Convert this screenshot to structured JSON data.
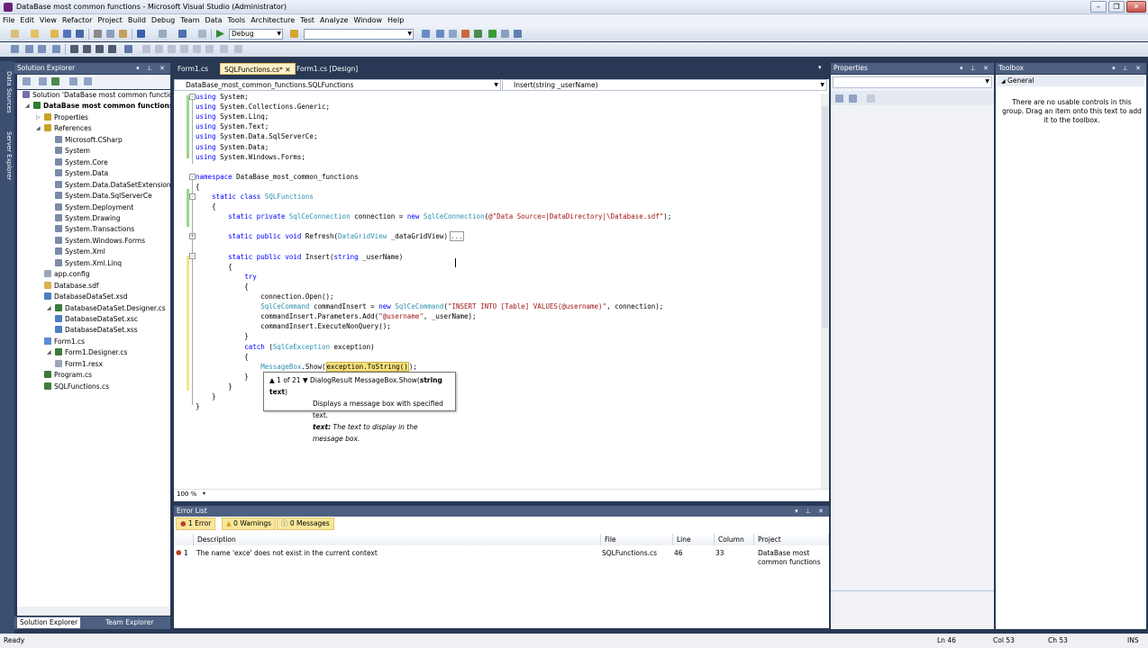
{
  "window": {
    "title": "DataBase most common functions - Microsoft Visual Studio (Administrator)"
  },
  "menu": [
    "File",
    "Edit",
    "View",
    "Refactor",
    "Project",
    "Build",
    "Debug",
    "Team",
    "Data",
    "Tools",
    "Architecture",
    "Test",
    "Analyze",
    "Window",
    "Help"
  ],
  "toolbar": {
    "config": "Debug",
    "search": ""
  },
  "left_strip": {
    "data_sources": "Data Sources",
    "server_explorer": "Server Explorer"
  },
  "solution_explorer": {
    "title": "Solution Explorer",
    "items": [
      {
        "label": "Solution 'DataBase most common functions'",
        "indent": 0,
        "color": "#7a6ab0"
      },
      {
        "label": "DataBase most common functions",
        "indent": 1,
        "color": "#2d7d2d",
        "bold": true
      },
      {
        "label": "Properties",
        "indent": 2,
        "color": "#c9a227"
      },
      {
        "label": "References",
        "indent": 2,
        "color": "#c9a227"
      },
      {
        "label": "Microsoft.CSharp",
        "indent": 3,
        "color": "#7b8ba8"
      },
      {
        "label": "System",
        "indent": 3,
        "color": "#7b8ba8"
      },
      {
        "label": "System.Core",
        "indent": 3,
        "color": "#7b8ba8"
      },
      {
        "label": "System.Data",
        "indent": 3,
        "color": "#7b8ba8"
      },
      {
        "label": "System.Data.DataSetExtensions",
        "indent": 3,
        "color": "#7b8ba8"
      },
      {
        "label": "System.Data.SqlServerCe",
        "indent": 3,
        "color": "#7b8ba8"
      },
      {
        "label": "System.Deployment",
        "indent": 3,
        "color": "#7b8ba8"
      },
      {
        "label": "System.Drawing",
        "indent": 3,
        "color": "#7b8ba8"
      },
      {
        "label": "System.Transactions",
        "indent": 3,
        "color": "#7b8ba8"
      },
      {
        "label": "System.Windows.Forms",
        "indent": 3,
        "color": "#7b8ba8"
      },
      {
        "label": "System.Xml",
        "indent": 3,
        "color": "#7b8ba8"
      },
      {
        "label": "System.Xml.Linq",
        "indent": 3,
        "color": "#7b8ba8"
      },
      {
        "label": "app.config",
        "indent": 2,
        "color": "#9aa6b8"
      },
      {
        "label": "Database.sdf",
        "indent": 2,
        "color": "#d8b24a"
      },
      {
        "label": "DatabaseDataSet.xsd",
        "indent": 2,
        "color": "#4a7fc0"
      },
      {
        "label": "DatabaseDataSet.Designer.cs",
        "indent": 3,
        "color": "#3e7a3e"
      },
      {
        "label": "DatabaseDataSet.xsc",
        "indent": 3,
        "color": "#4a7fc0"
      },
      {
        "label": "DatabaseDataSet.xss",
        "indent": 3,
        "color": "#4a7fc0"
      },
      {
        "label": "Form1.cs",
        "indent": 2,
        "color": "#5b8bd0"
      },
      {
        "label": "Form1.Designer.cs",
        "indent": 3,
        "color": "#3e7a3e"
      },
      {
        "label": "Form1.resx",
        "indent": 3,
        "color": "#9aa6b8"
      },
      {
        "label": "Program.cs",
        "indent": 2,
        "color": "#3e7a3e"
      },
      {
        "label": "SQLFunctions.cs",
        "indent": 2,
        "color": "#3e7a3e"
      }
    ],
    "bottom_tabs": [
      "Solution Explorer",
      "Team Explorer"
    ]
  },
  "doc_tabs": [
    "Form1.cs",
    "SQLFunctions.cs*",
    "Form1.cs [Design]"
  ],
  "editor": {
    "nav_left": "DataBase_most_common_functions.SQLFunctions",
    "nav_right": "Insert(string _userName)",
    "zoom": "100 %",
    "lines": [
      [
        "kw:using",
        "t: System;"
      ],
      [
        "kw:using",
        "t: System.Collections.Generic;"
      ],
      [
        "kw:using",
        "t: System.Linq;"
      ],
      [
        "kw:using",
        "t: System.Text;"
      ],
      [
        "kw:using",
        "t: System.Data.SqlServerCe;"
      ],
      [
        "kw:using",
        "t: System.Data;"
      ],
      [
        "kw:using",
        "t: System.Windows.Forms;"
      ],
      [
        "t:"
      ],
      [
        "kw:namespace",
        "t: DataBase_most_common_functions"
      ],
      [
        "t:{"
      ],
      [
        "t:    ",
        "kw:static class ",
        "ty:SQLFunctions"
      ],
      [
        "t:    {"
      ],
      [
        "t:        ",
        "kw:static private ",
        "ty:SqlCeConnection",
        "t: connection = ",
        "kw:new ",
        "ty:SqlCeConnection",
        "t:(",
        "st:@\"Data Source=|DataDirectory|\\Database.sdf\"",
        "t:);"
      ],
      [
        "t:"
      ],
      [
        "t:        ",
        "kw:static public void ",
        "t:Refresh(",
        "ty:DataGridView",
        "t: _dataGridView)",
        "b:..."
      ],
      [
        "t:"
      ],
      [
        "t:        ",
        "kw:static public void ",
        "t:Insert(",
        "kw:string",
        "t: _userName)"
      ],
      [
        "t:        {"
      ],
      [
        "t:            ",
        "kw:try"
      ],
      [
        "t:            {"
      ],
      [
        "t:                connection.Open();"
      ],
      [
        "t:                ",
        "ty:SqlCeCommand",
        "t: commandInsert = ",
        "kw:new ",
        "ty:SqlCeCommand",
        "t:(",
        "st:\"INSERT INTO [Table] VALUES(@username)\"",
        "t:, connection);"
      ],
      [
        "t:                commandInsert.Parameters.Add(",
        "st:\"@username\"",
        "t:, _userName);"
      ],
      [
        "t:                commandInsert.ExecuteNonQuery();"
      ],
      [
        "t:            }"
      ],
      [
        "t:            ",
        "kw:catch ",
        "t:(",
        "ty:SqlCeException",
        "t: exception)"
      ],
      [
        "t:            {"
      ],
      [
        "t:                ",
        "ty:MessageBox",
        "t:.Show(",
        "h:exception.ToString()",
        "t:);"
      ],
      [
        "t:            }"
      ],
      [
        "t:        }"
      ],
      [
        "t:    }"
      ],
      [
        "t:}"
      ]
    ]
  },
  "tooltip": {
    "counter": "1 of 21",
    "signature_prefix": "DialogResult MessageBox.Show(",
    "signature_param": "string text",
    "signature_suffix": ")",
    "description": "Displays a message box with specified text.",
    "param_name": "text:",
    "param_desc": "The text to display in the message box."
  },
  "properties": {
    "title": "Properties"
  },
  "toolbox": {
    "title": "Toolbox",
    "group": "General",
    "message": "There are no usable controls in this group. Drag an item onto this text to add it to the toolbox."
  },
  "error_list": {
    "title": "Error List",
    "tabs": [
      "1 Error",
      "0 Warnings",
      "0 Messages"
    ],
    "columns": [
      "Description",
      "File",
      "Line",
      "Column",
      "Project"
    ],
    "rows": [
      {
        "num": "1",
        "description": "The name 'exce' does not exist in the current context",
        "file": "SQLFunctions.cs",
        "line": "46",
        "column": "33",
        "project": "DataBase most common functions"
      }
    ]
  },
  "status": {
    "left": "Ready",
    "ln": "Ln 46",
    "col": "Col 53",
    "ch": "Ch 53",
    "mode": "INS"
  }
}
